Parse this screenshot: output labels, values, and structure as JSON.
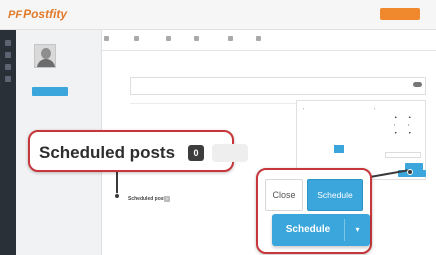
{
  "app": {
    "logo_text": "Postfity",
    "logo_mark": "PF",
    "upgrade_label": ""
  },
  "sidebar": {
    "account_name": "",
    "add_account_label": ""
  },
  "tabs": [
    {
      "label": ""
    },
    {
      "label": ""
    },
    {
      "label": ""
    },
    {
      "label": ""
    },
    {
      "label": ""
    },
    {
      "label": ""
    }
  ],
  "compose": {
    "label": "",
    "placeholder": ""
  },
  "datepicker": {
    "month_label": "",
    "prev_glyph": "‹",
    "next_glyph": "›",
    "weekday_headers": [
      "",
      "",
      "",
      "",
      "",
      "",
      ""
    ],
    "days": [
      "",
      "",
      "",
      "",
      "",
      "",
      "",
      "",
      "",
      "",
      "",
      "",
      "",
      "",
      "",
      "",
      "",
      "",
      "",
      "",
      "",
      "",
      "",
      "",
      "",
      "",
      "",
      "",
      "",
      "",
      "",
      "",
      "",
      "",
      ""
    ],
    "selected_index": 24,
    "time_label": "",
    "timezone_label": "",
    "timezone_value": "",
    "close_label": "",
    "schedule_label": ""
  },
  "scheduled_small": {
    "title": "Scheduled posts",
    "count": "0",
    "filters": [
      "",
      "",
      "",
      ""
    ],
    "post_title": "",
    "post_text": "",
    "right_link": ""
  },
  "callout_scheduled": {
    "label": "Scheduled posts",
    "count": "0"
  },
  "callout_actions": {
    "close_label": "Close",
    "schedule_label": "Schedule",
    "split_schedule_label": "Schedule",
    "caret_glyph": "▾"
  },
  "colors": {
    "accent_blue": "#3aa6db",
    "callout_border": "#c6363a",
    "brand_orange": "#e27a2c",
    "dark_rail": "#2a3038"
  }
}
